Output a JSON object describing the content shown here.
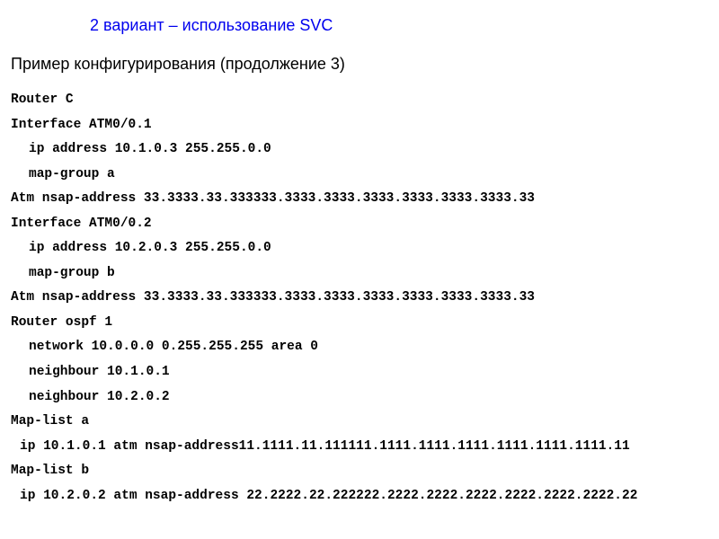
{
  "title": "2 вариант – использование SVC",
  "subtitle": "Пример конфигурирования (продолжение 3)",
  "config": {
    "line0": "Router C",
    "line1": "Interface ATM0/0.1",
    "line2": "ip address 10.1.0.3 255.255.0.0",
    "line3": "map-group a",
    "line4": "Atm nsap-address 33.3333.33.333333.3333.3333.3333.3333.3333.3333.33",
    "line5": "Interface ATM0/0.2",
    "line6": "ip address 10.2.0.3 255.255.0.0",
    "line7": "map-group b",
    "line8": "Atm nsap-address 33.3333.33.333333.3333.3333.3333.3333.3333.3333.33",
    "line9": "Router ospf 1",
    "line10": "network 10.0.0.0 0.255.255.255 area 0",
    "line11": "neighbour 10.1.0.1",
    "line12": "neighbour 10.2.0.2",
    "line13": "Map-list a",
    "line14": "ip 10.1.0.1 atm nsap-address11.1111.11.111111.1111.1111.1111.1111.1111.1111.11",
    "line15": "Map-list b",
    "line16": "ip 10.2.0.2 atm nsap-address 22.2222.22.222222.2222.2222.2222.2222.2222.2222.22"
  }
}
